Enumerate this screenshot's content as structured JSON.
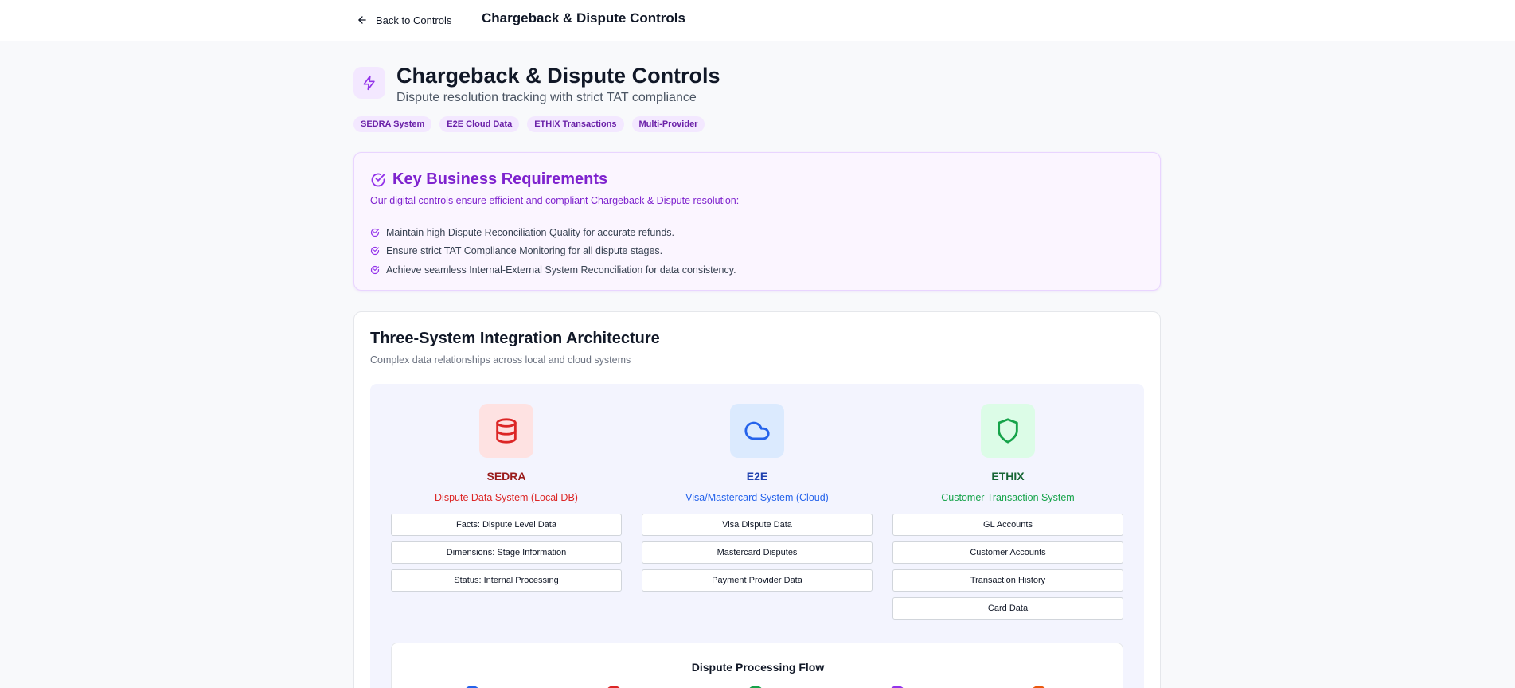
{
  "topbar": {
    "back_label": "Back to Controls",
    "title": "Chargeback & Dispute Controls"
  },
  "header": {
    "icon": "lightning-icon",
    "title": "Chargeback & Dispute Controls",
    "subtitle": "Dispute resolution tracking with strict TAT compliance"
  },
  "tags": [
    "SEDRA System",
    "E2E Cloud Data",
    "ETHIX Transactions",
    "Multi-Provider"
  ],
  "requirements": {
    "title": "Key Business Requirements",
    "intro": "Our digital controls ensure efficient and compliant Chargeback & Dispute resolution:",
    "items": [
      "Maintain high Dispute Reconciliation Quality for accurate refunds.",
      "Ensure strict TAT Compliance Monitoring for all dispute stages.",
      "Achieve seamless Internal-External System Reconciliation for data consistency."
    ]
  },
  "architecture": {
    "title": "Three-System Integration Architecture",
    "subtitle": "Complex data relationships across local and cloud systems",
    "systems": [
      {
        "name": "SEDRA",
        "description": "Dispute Data System (Local DB)",
        "icon": "database-icon",
        "color": "#dc2626",
        "name_color": "#991b1b",
        "icon_bg": "#fee2e2",
        "items": [
          "Facts: Dispute Level Data",
          "Dimensions: Stage Information",
          "Status: Internal Processing"
        ]
      },
      {
        "name": "E2E",
        "description": "Visa/Mastercard System (Cloud)",
        "icon": "cloud-icon",
        "color": "#2563eb",
        "name_color": "#1e40af",
        "icon_bg": "#dbeafe",
        "items": [
          "Visa Dispute Data",
          "Mastercard Disputes",
          "Payment Provider Data"
        ]
      },
      {
        "name": "ETHIX",
        "description": "Customer Transaction System",
        "icon": "shield-icon",
        "color": "#16a34a",
        "name_color": "#166534",
        "icon_bg": "#dcfce7",
        "items": [
          "GL Accounts",
          "Customer Accounts",
          "Transaction History",
          "Card Data"
        ]
      }
    ],
    "flow": {
      "title": "Dispute Processing Flow",
      "step_colors": [
        "#2563eb",
        "#dc2626",
        "#16a34a",
        "#9333ea",
        "#ea580c"
      ]
    }
  }
}
